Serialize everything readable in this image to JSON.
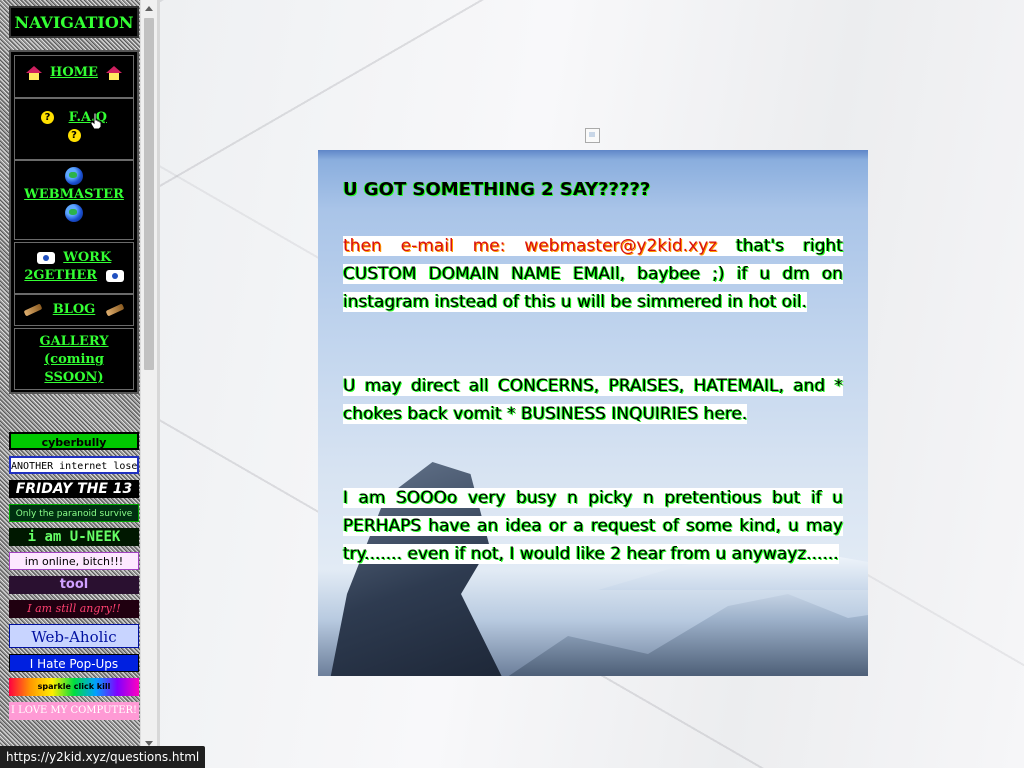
{
  "nav": {
    "header": "NAVIGATION",
    "items": [
      {
        "label": "HOME",
        "icon": "house-icon"
      },
      {
        "label": "F.A.Q",
        "icon": "question-icon"
      },
      {
        "label": "WEBMASTER",
        "icon": "globe-icon"
      },
      {
        "label_line1": "WORK",
        "label_line2": "2GETHER",
        "icon": "handshake-icon"
      },
      {
        "label": "BLOG",
        "icon": "pen-icon"
      },
      {
        "label_line1": "GALLERY",
        "label_line2": "(coming",
        "label_line3": "SSOON)"
      }
    ]
  },
  "banners": [
    {
      "text": "cyberbully"
    },
    {
      "text": "ANOTHER internet loser"
    },
    {
      "text": "FRIDAY THE 13"
    },
    {
      "text": "Only the paranoid survive"
    },
    {
      "text": "i am U-NEEK"
    },
    {
      "text": "im online, bitch!!!"
    },
    {
      "text": "tool"
    },
    {
      "text": "I am still angry!!"
    },
    {
      "text": "Web-Aholic"
    },
    {
      "text": "I Hate Pop-Ups"
    },
    {
      "text": "sparkle click kill"
    },
    {
      "text": "I LOVE MY COMPUTER!"
    }
  ],
  "content": {
    "heading": "U GOT SOMETHING 2 SAY?????",
    "email_prefix": "then e-mail me: webmaster@y2kid.xyz",
    "email_rest": " that's right CUSTOM DOMAIN NAME EMAIl, baybee ;) if u dm on instagram instead of this u will be simmered in hot oil.",
    "para2": "U may direct all CONCERNS, PRAISES, HATEMAIL, and * chokes back vomit * BUSINESS INQUIRIES here.",
    "para3": "I am SOOOo very busy n picky n pretentious but if u PERHAPS have an idea or a request of some kind, u may try....... even if not, I would like 2 hear from u anywayz......"
  },
  "status_bar": {
    "url": "https://y2kid.xyz/questions.html"
  },
  "colors": {
    "nav_green": "#33ff33",
    "highlight_red": "#d81010",
    "text_glow": "#23ff23"
  }
}
